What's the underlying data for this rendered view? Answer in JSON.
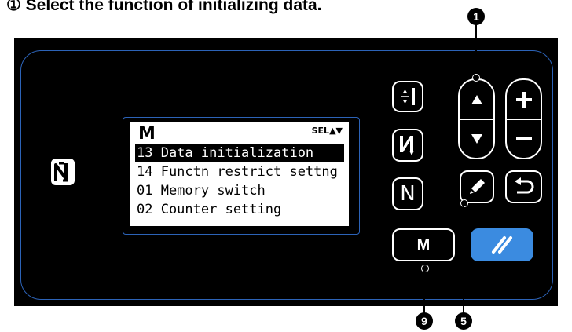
{
  "heading": {
    "text": "① Select the function of initializing data."
  },
  "lcd": {
    "mode_label": "M",
    "sel_label": "SEL▲▼",
    "rows": [
      {
        "label": "13 Data initialization",
        "selected": true
      },
      {
        "label": "14 Functn restrict settng",
        "selected": false
      },
      {
        "label": "01 Memory switch",
        "selected": false
      },
      {
        "label": "02 Counter setting",
        "selected": false
      }
    ]
  },
  "buttons": {
    "m_label": "M",
    "n_label": "N"
  },
  "callouts": {
    "c1": "1",
    "c9": "9",
    "c5": "5"
  },
  "colors": {
    "panel": "#000000",
    "frame": "#2c63b8",
    "reset_button": "#3b8be0"
  }
}
